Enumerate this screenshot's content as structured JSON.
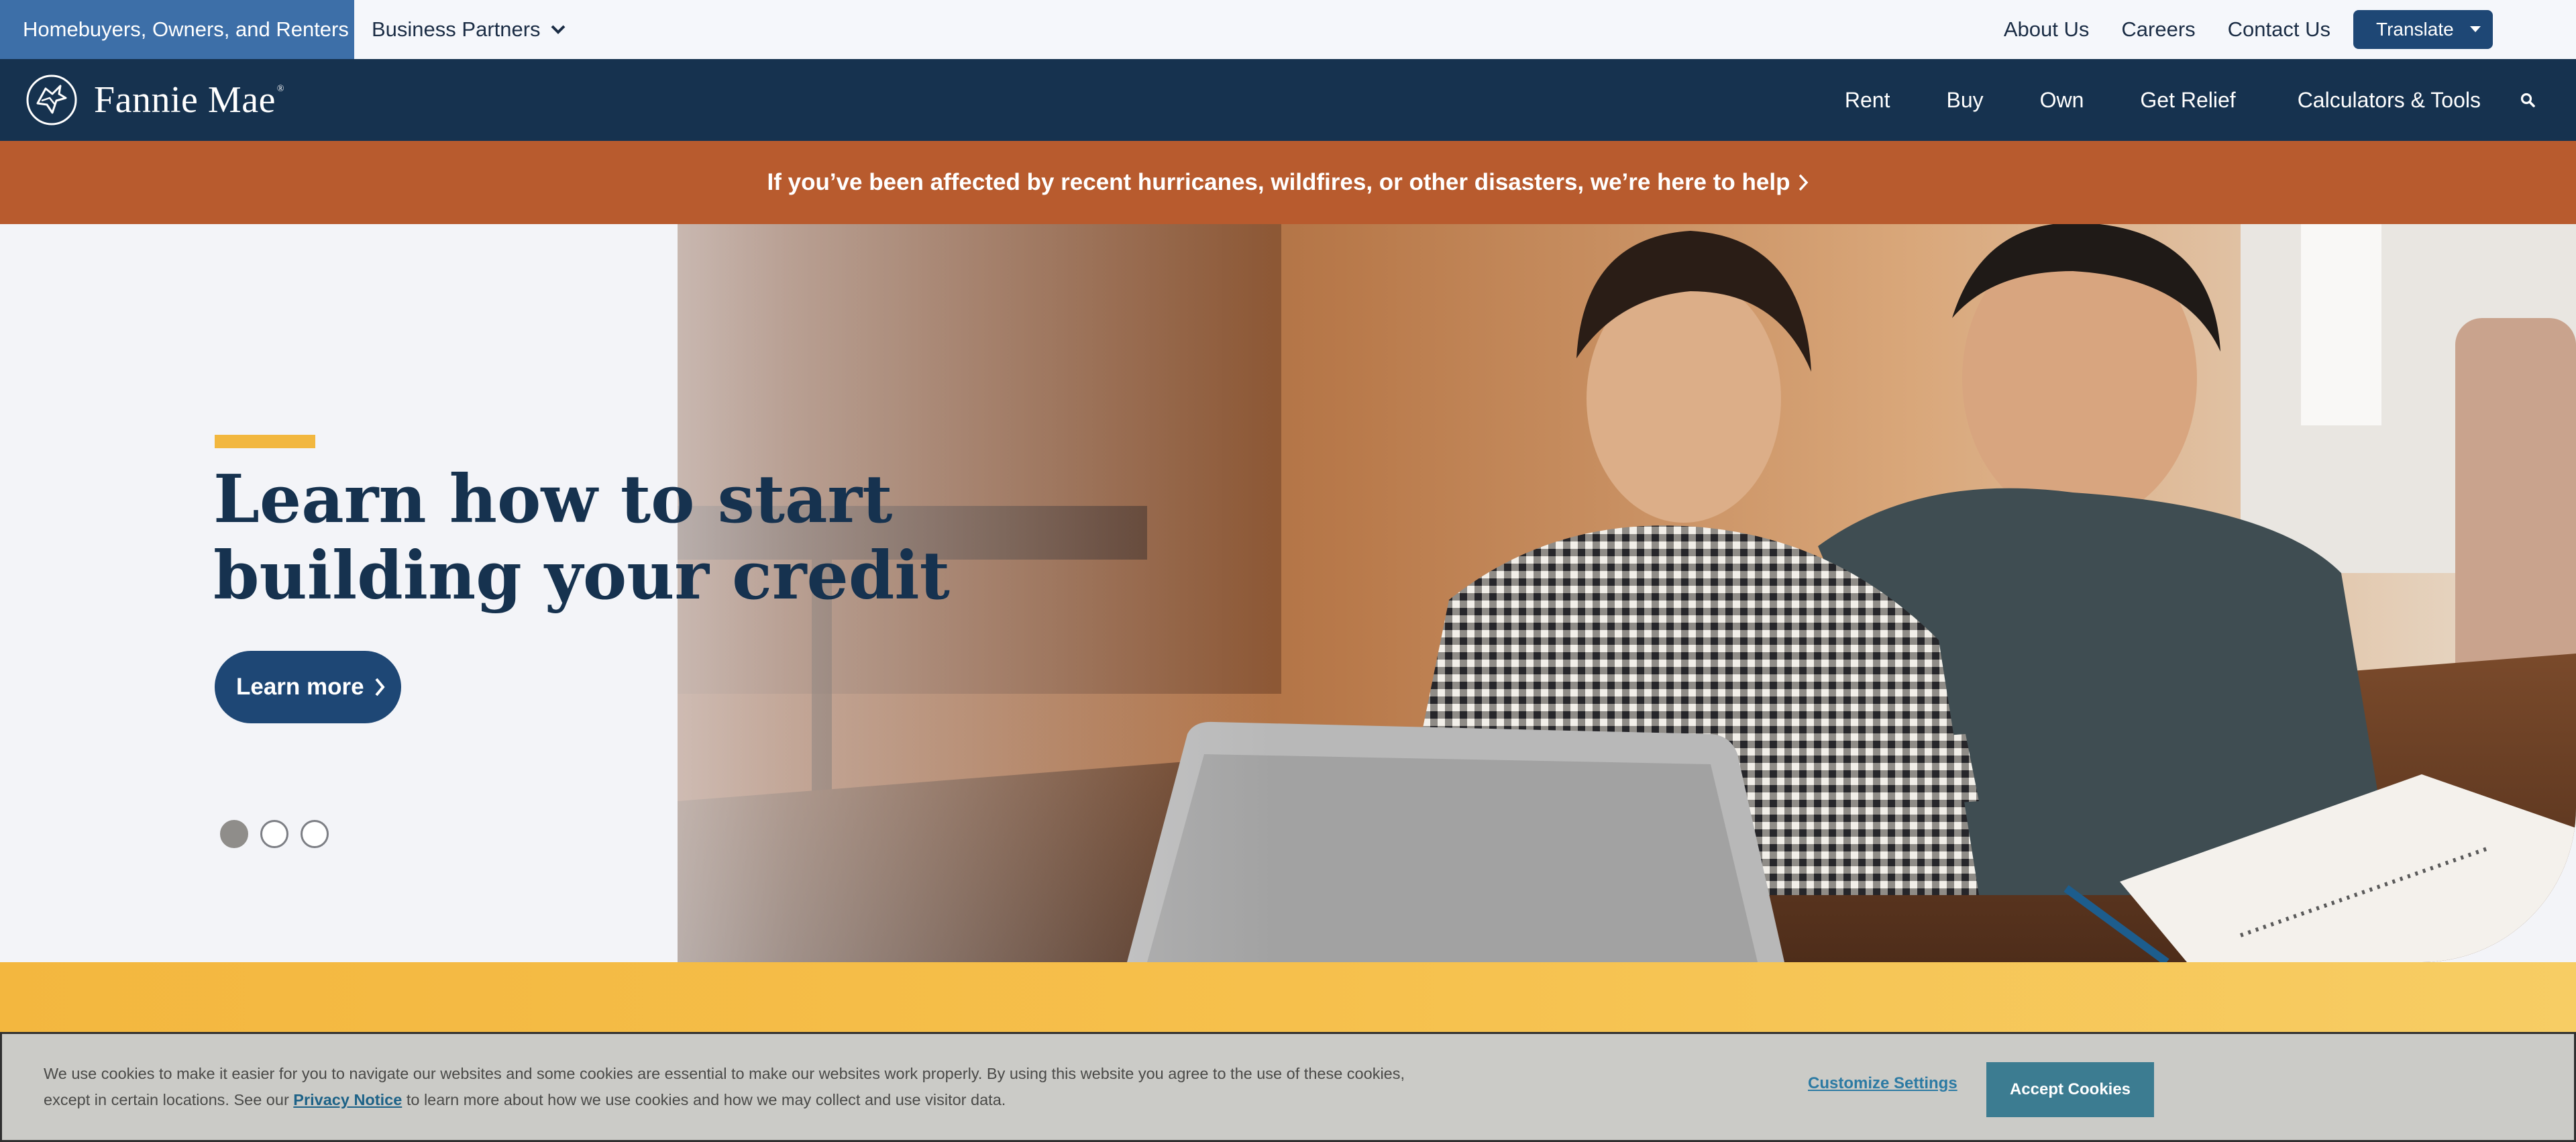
{
  "utility_bar": {
    "audience_tab": "Homebuyers, Owners, and Renters",
    "partners_tab": "Business Partners",
    "links": [
      "About Us",
      "Careers",
      "Contact Us"
    ],
    "translate_label": "Translate"
  },
  "nav": {
    "brand": "Fannie Mae",
    "brand_mark": "®",
    "items": [
      "Rent",
      "Buy",
      "Own",
      "Get Relief",
      "Calculators & Tools"
    ]
  },
  "alert": {
    "text": "If you’ve been affected by recent hurricanes, wildfires, or other disasters, we’re here to help"
  },
  "hero": {
    "title_line1": "Learn how to start",
    "title_line2": "building your credit",
    "cta_label": "Learn more",
    "slides_total": 3,
    "active_slide": 1
  },
  "cookie": {
    "text_before_link": "We use cookies to make it easier for you to navigate our websites and some cookies are essential to make our websites work properly. By using this website you agree to the use of these cookies, except in certain locations. See our",
    "link_text": "Privacy Notice",
    "text_after_link": "to learn more about how we use cookies and how we may collect and use visitor data.",
    "customize_label": "Customize Settings",
    "accept_label": "Accept Cookies"
  },
  "colors": {
    "navy": "#16324f",
    "audience_tab_blue": "#3d6fa8",
    "button_blue": "#1e4775",
    "alert_orange": "#b85b2e",
    "accent_yellow": "#f2b73f",
    "cookie_bg": "#cbcbc7",
    "accept_teal": "#3c7c91"
  },
  "icons": {
    "partners_dropdown": "chevron-down-icon",
    "translate_dropdown": "caret-down-icon",
    "search": "search-icon",
    "alert_arrow": "chevron-right-icon",
    "cta_arrow": "chevron-right-icon",
    "logo": "fannie-mae-house-logo-icon"
  }
}
